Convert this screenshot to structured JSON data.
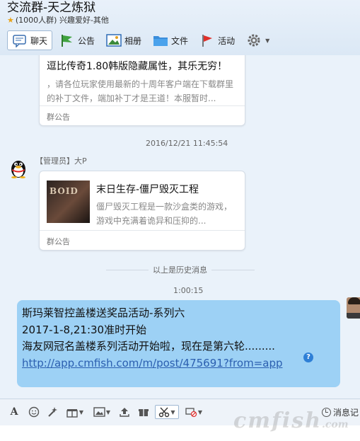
{
  "header": {
    "title": "交流群-天之炼狱",
    "meta": "(1000人群) 兴趣爱好-其他",
    "tabs": [
      {
        "label": "聊天",
        "icon": "chat-bubble-icon"
      },
      {
        "label": "公告",
        "icon": "flag-icon"
      },
      {
        "label": "相册",
        "icon": "photo-album-icon"
      },
      {
        "label": "文件",
        "icon": "folder-icon"
      },
      {
        "label": "活动",
        "icon": "red-flag-icon"
      }
    ]
  },
  "messages": {
    "notice1": {
      "title": "逗比传奇1.80韩版隐藏属性，其乐无穷！",
      "body": "，请各位玩家使用最新的十周年客户端在下载群里的补丁文件，端加补丁才是王道！本服暂时...",
      "footer": "群公告"
    },
    "timestamp1": "2016/12/21 11:45:54",
    "sender": "【管理员】大P",
    "notice2": {
      "title": "末日生存-僵尸毁灭工程",
      "body": "僵尸毁灭工程是一款沙盒类的游戏，游戏中充满着诡异和压抑的...",
      "footer": "群公告",
      "thumb_text": "BOID"
    },
    "history_label": "以上是历史消息",
    "timestamp2": "1:00:15",
    "bubble": {
      "line1": "斯玛莱智控盖楼送奖品活动-系列六",
      "line2": "2017-1-8,21:30准时开始",
      "line3": "海友网冠名盖楼系列活动开始啦，现在是第六轮.........",
      "link": "http://app.cmfish.com/m/post/475691?from=app",
      "color": "#9dd1f5"
    }
  },
  "toolbar": {
    "record_label": "消息记"
  },
  "watermark": {
    "text": "cmfish",
    "suffix": ".com"
  }
}
